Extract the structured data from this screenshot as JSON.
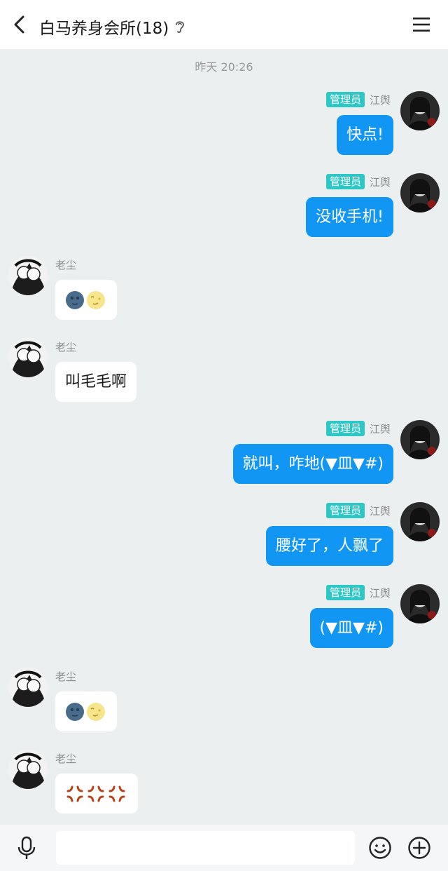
{
  "header": {
    "title": "白马养身会所(18)"
  },
  "timestamp": "昨天 20:26",
  "messages": [
    {
      "side": "right",
      "badge": "管理员",
      "sender": "江舆",
      "text": "快点!"
    },
    {
      "side": "right",
      "badge": "管理员",
      "sender": "江舆",
      "text": "没收手机!"
    },
    {
      "side": "left",
      "sender": "老尘",
      "emoji": [
        "new-moon-face",
        "full-moon-face"
      ]
    },
    {
      "side": "left",
      "sender": "老尘",
      "text": "叫毛毛啊"
    },
    {
      "side": "right",
      "badge": "管理员",
      "sender": "江舆",
      "text": "就叫，咋地(▼皿▼#)"
    },
    {
      "side": "right",
      "badge": "管理员",
      "sender": "江舆",
      "text": "腰好了，人飘了"
    },
    {
      "side": "right",
      "badge": "管理员",
      "sender": "江舆",
      "text": "(▼皿▼#)"
    },
    {
      "side": "left",
      "sender": "老尘",
      "emoji": [
        "new-moon-face",
        "full-moon-face"
      ]
    },
    {
      "side": "left",
      "sender": "老尘",
      "emoji": [
        "anger-symbol",
        "anger-symbol",
        "anger-symbol"
      ]
    }
  ],
  "input": {
    "placeholder": ""
  },
  "colors": {
    "accent": "#1296f3",
    "badge": "#2fc6c6",
    "background": "#ebeff0"
  }
}
